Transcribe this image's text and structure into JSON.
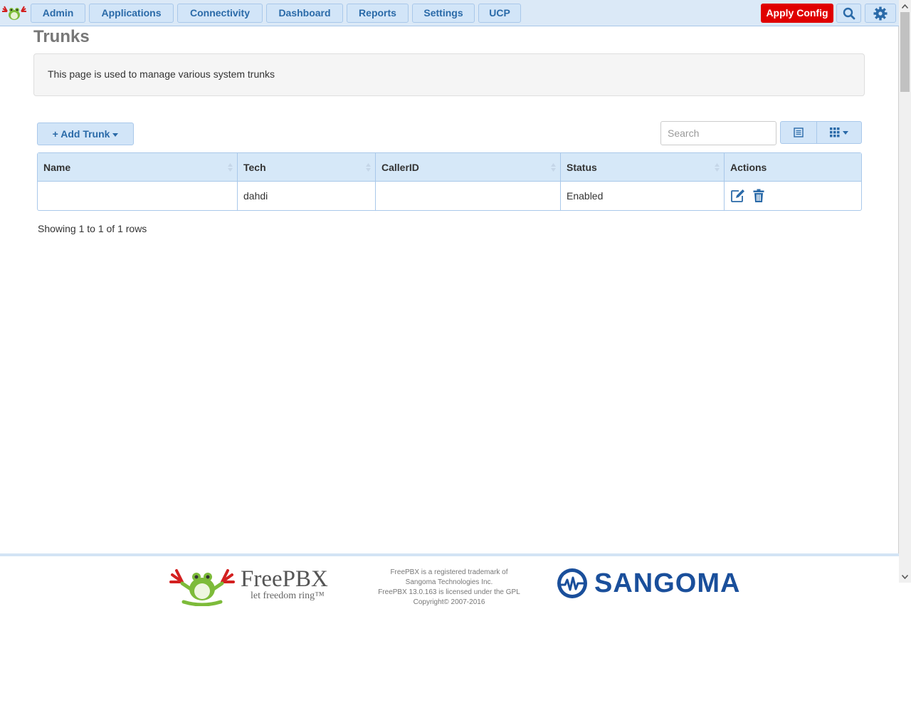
{
  "nav": {
    "items": [
      "Admin",
      "Applications",
      "Connectivity",
      "Dashboard",
      "Reports",
      "Settings",
      "UCP"
    ],
    "apply_config": "Apply Config"
  },
  "page": {
    "title": "Trunks",
    "description": "This page is used to manage various system trunks"
  },
  "toolbar": {
    "add_trunk": "Add Trunk",
    "search_placeholder": "Search"
  },
  "table": {
    "columns": [
      "Name",
      "Tech",
      "CallerID",
      "Status",
      "Actions"
    ],
    "rows": [
      {
        "name": "",
        "tech": "dahdi",
        "callerid": "",
        "status": "Enabled"
      }
    ]
  },
  "pagination": {
    "summary": "Showing 1 to 1 of 1 rows"
  },
  "footer": {
    "freepbx_name": "FreePBX",
    "freepbx_tagline": "let freedom ring™",
    "legal_lines": [
      "FreePBX is a registered trademark of",
      "Sangoma Technologies Inc.",
      "FreePBX 13.0.163 is licensed under the GPL",
      "Copyright© 2007-2016"
    ],
    "sangoma_name": "SANGOMA"
  },
  "colors": {
    "accent": "#2a6aa8",
    "nav_background": "#dbe9f7",
    "apply_button": "#e00000"
  },
  "icons": {
    "nav_search": "search-icon",
    "nav_settings": "gear-icon",
    "add": "plus-icon",
    "edit": "edit-icon",
    "delete": "trash-icon",
    "view_list": "list-icon",
    "view_columns": "grid-icon"
  }
}
